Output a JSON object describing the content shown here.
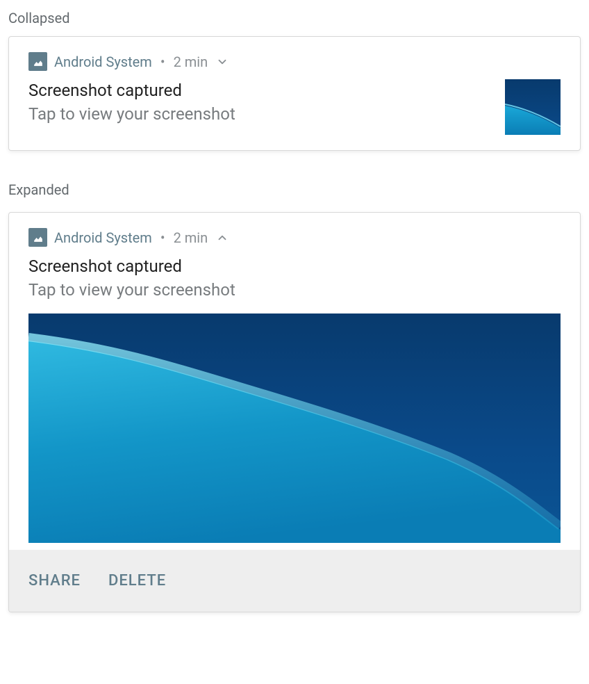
{
  "labels": {
    "collapsed": "Collapsed",
    "expanded": "Expanded"
  },
  "collapsed": {
    "app_name": "Android  System",
    "separator": "•",
    "timestamp": "2 min",
    "title": "Screenshot captured",
    "subtitle": "Tap to view your screenshot"
  },
  "expanded": {
    "app_name": "Android  System",
    "separator": "•",
    "timestamp": "2 min",
    "title": "Screenshot captured",
    "subtitle": "Tap to view your screenshot",
    "actions": {
      "share": "SHARE",
      "delete": "DELETE"
    }
  }
}
